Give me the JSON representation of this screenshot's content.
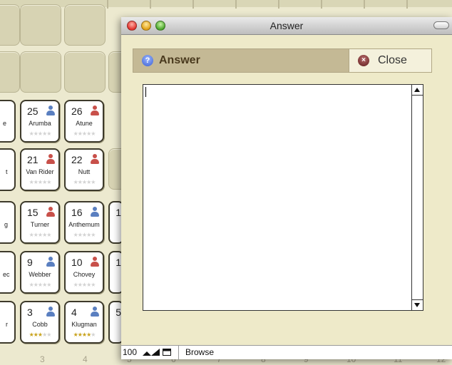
{
  "background": {
    "cards": [
      {
        "num": "25",
        "name": "Arumba",
        "stars": 0,
        "gender": "male"
      },
      {
        "num": "26",
        "name": "Atune",
        "stars": 0,
        "gender": "female"
      },
      {
        "num": "21",
        "name": "Van Rider",
        "stars": 0,
        "gender": "female"
      },
      {
        "num": "22",
        "name": "Nutt",
        "stars": 0,
        "gender": "female"
      },
      {
        "num": "15",
        "name": "Turner",
        "stars": 0,
        "gender": "female"
      },
      {
        "num": "16",
        "name": "Anthemum",
        "stars": 0,
        "gender": "male"
      },
      {
        "num": "9",
        "name": "Webber",
        "stars": 0,
        "gender": "male"
      },
      {
        "num": "10",
        "name": "Chovey",
        "stars": 0,
        "gender": "female"
      },
      {
        "num": "3",
        "name": "Cobb",
        "stars": 3,
        "gender": "male"
      },
      {
        "num": "4",
        "name": "Klugman",
        "stars": 4,
        "gender": "male"
      }
    ],
    "left_fragments": [
      "e",
      "t",
      "g",
      "ec",
      "r"
    ],
    "right_fragments": [
      {
        "num": "1",
        "frag": ""
      },
      {
        "num": "1",
        "frag": ""
      },
      {
        "num": "5",
        "frag": ""
      }
    ],
    "column_labels": [
      "3",
      "4",
      "5",
      "6",
      "7",
      "8",
      "9",
      "10",
      "11",
      "12"
    ]
  },
  "window": {
    "title": "Answer",
    "header_title": "Answer",
    "close_label": "Close",
    "answer_text": ""
  },
  "status": {
    "zoom": "100",
    "mode": "Browse"
  },
  "colors": {
    "accent_header": "#c4b995",
    "background": "#ece9cf",
    "female_icon": "#c8504a",
    "male_icon": "#5a7fc0"
  }
}
